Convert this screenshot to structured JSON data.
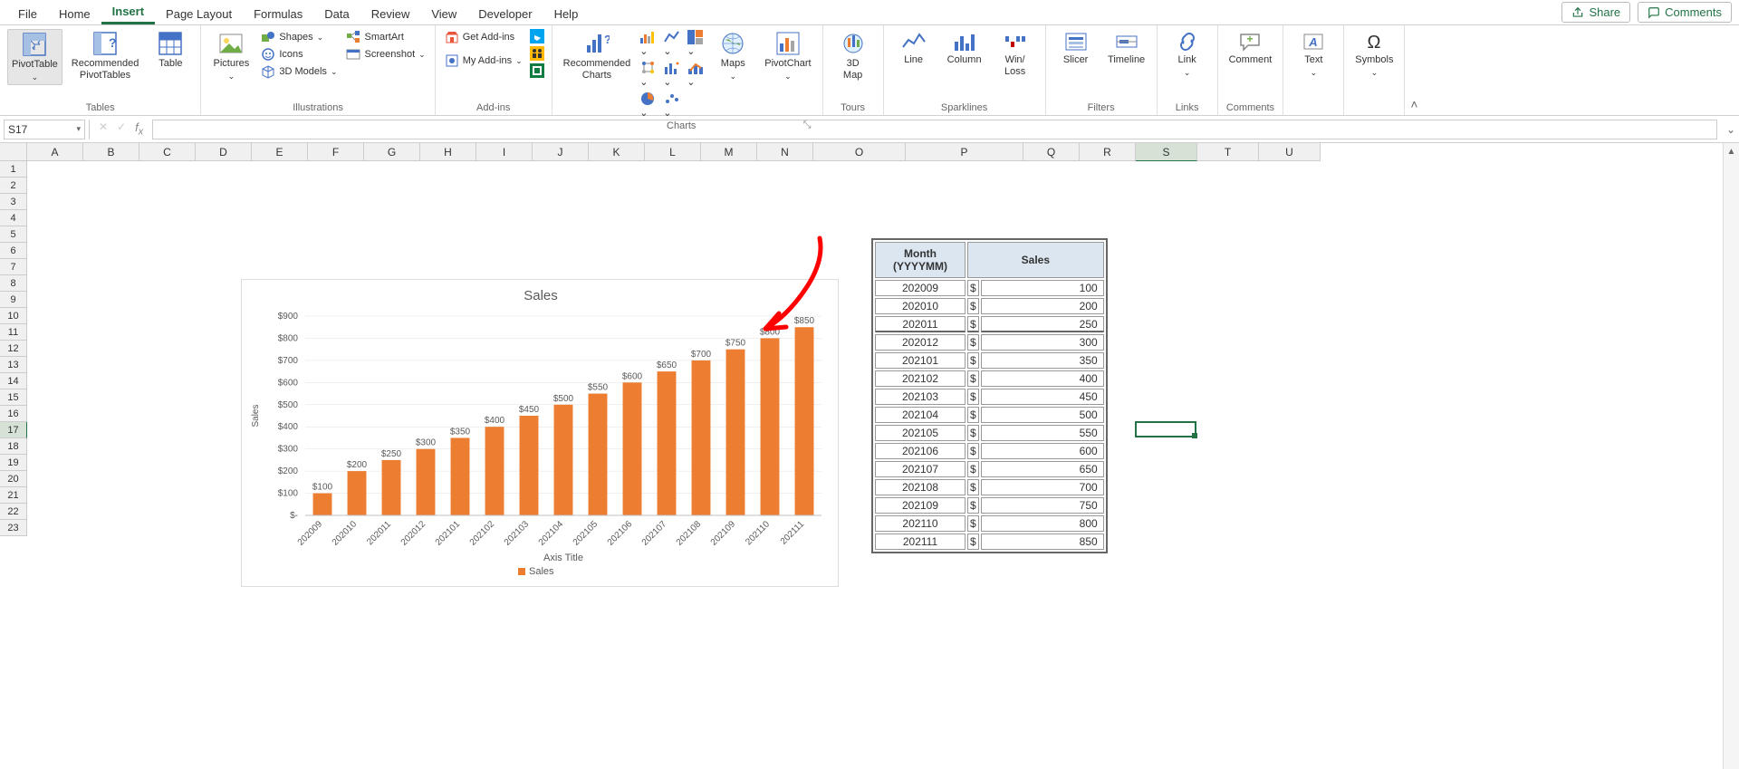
{
  "tabs": [
    "File",
    "Home",
    "Insert",
    "Page Layout",
    "Formulas",
    "Data",
    "Review",
    "View",
    "Developer",
    "Help"
  ],
  "active_tab": "Insert",
  "share": "Share",
  "comments": "Comments",
  "ribbon": {
    "tables": {
      "pivot": "PivotTable",
      "recpivot": "Recommended\nPivotTables",
      "table": "Table",
      "group": "Tables"
    },
    "illus": {
      "pictures": "Pictures",
      "shapes": "Shapes",
      "icons": "Icons",
      "models": "3D Models",
      "smartart": "SmartArt",
      "screenshot": "Screenshot",
      "group": "Illustrations"
    },
    "addins": {
      "get": "Get Add-ins",
      "my": "My Add-ins",
      "group": "Add-ins"
    },
    "charts": {
      "rec": "Recommended\nCharts",
      "maps": "Maps",
      "pivotchart": "PivotChart",
      "group": "Charts"
    },
    "tours": {
      "map": "3D\nMap",
      "group": "Tours"
    },
    "spark": {
      "line": "Line",
      "column": "Column",
      "winloss": "Win/\nLoss",
      "group": "Sparklines"
    },
    "filters": {
      "slicer": "Slicer",
      "timeline": "Timeline",
      "group": "Filters"
    },
    "links": {
      "link": "Link",
      "group": "Links"
    },
    "comments_g": {
      "comment": "Comment",
      "group": "Comments"
    },
    "text": {
      "text": "Text",
      "group": ""
    },
    "symbols": {
      "symbols": "Symbols",
      "group": ""
    }
  },
  "namebox": "S17",
  "columns": [
    "A",
    "B",
    "C",
    "D",
    "E",
    "F",
    "G",
    "H",
    "I",
    "J",
    "K",
    "L",
    "M",
    "N",
    "O",
    "P",
    "Q",
    "R",
    "S",
    "T",
    "U"
  ],
  "rows_visible": 23,
  "selected_col": "S",
  "selected_row": 17,
  "table": {
    "headers": [
      "Month (YYYYMM)",
      "Sales"
    ],
    "rows": [
      [
        "202009",
        "$",
        "100"
      ],
      [
        "202010",
        "$",
        "200"
      ],
      [
        "202011",
        "$",
        "250"
      ],
      [
        "202012",
        "$",
        "300"
      ],
      [
        "202101",
        "$",
        "350"
      ],
      [
        "202102",
        "$",
        "400"
      ],
      [
        "202103",
        "$",
        "450"
      ],
      [
        "202104",
        "$",
        "500"
      ],
      [
        "202105",
        "$",
        "550"
      ],
      [
        "202106",
        "$",
        "600"
      ],
      [
        "202107",
        "$",
        "650"
      ],
      [
        "202108",
        "$",
        "700"
      ],
      [
        "202109",
        "$",
        "750"
      ],
      [
        "202110",
        "$",
        "800"
      ],
      [
        "202111",
        "$",
        "850"
      ]
    ]
  },
  "chart_data": {
    "type": "bar",
    "title": "Sales",
    "xlabel": "Axis Title",
    "ylabel": "Sales",
    "legend": "Sales",
    "categories": [
      "202009",
      "202010",
      "202011",
      "202012",
      "202101",
      "202102",
      "202103",
      "202104",
      "202105",
      "202106",
      "202107",
      "202108",
      "202109",
      "202110",
      "202111"
    ],
    "values": [
      100,
      200,
      250,
      300,
      350,
      400,
      450,
      500,
      550,
      600,
      650,
      700,
      750,
      800,
      850
    ],
    "data_labels": [
      "$100",
      "$200",
      "$250",
      "$300",
      "$350",
      "$400",
      "$450",
      "$500",
      "$550",
      "$600",
      "$650",
      "$700",
      "$750",
      "$800",
      "$850"
    ],
    "yticks": [
      "$-",
      "$100",
      "$200",
      "$300",
      "$400",
      "$500",
      "$600",
      "$700",
      "$800",
      "$900"
    ],
    "ylim": [
      0,
      900
    ]
  }
}
